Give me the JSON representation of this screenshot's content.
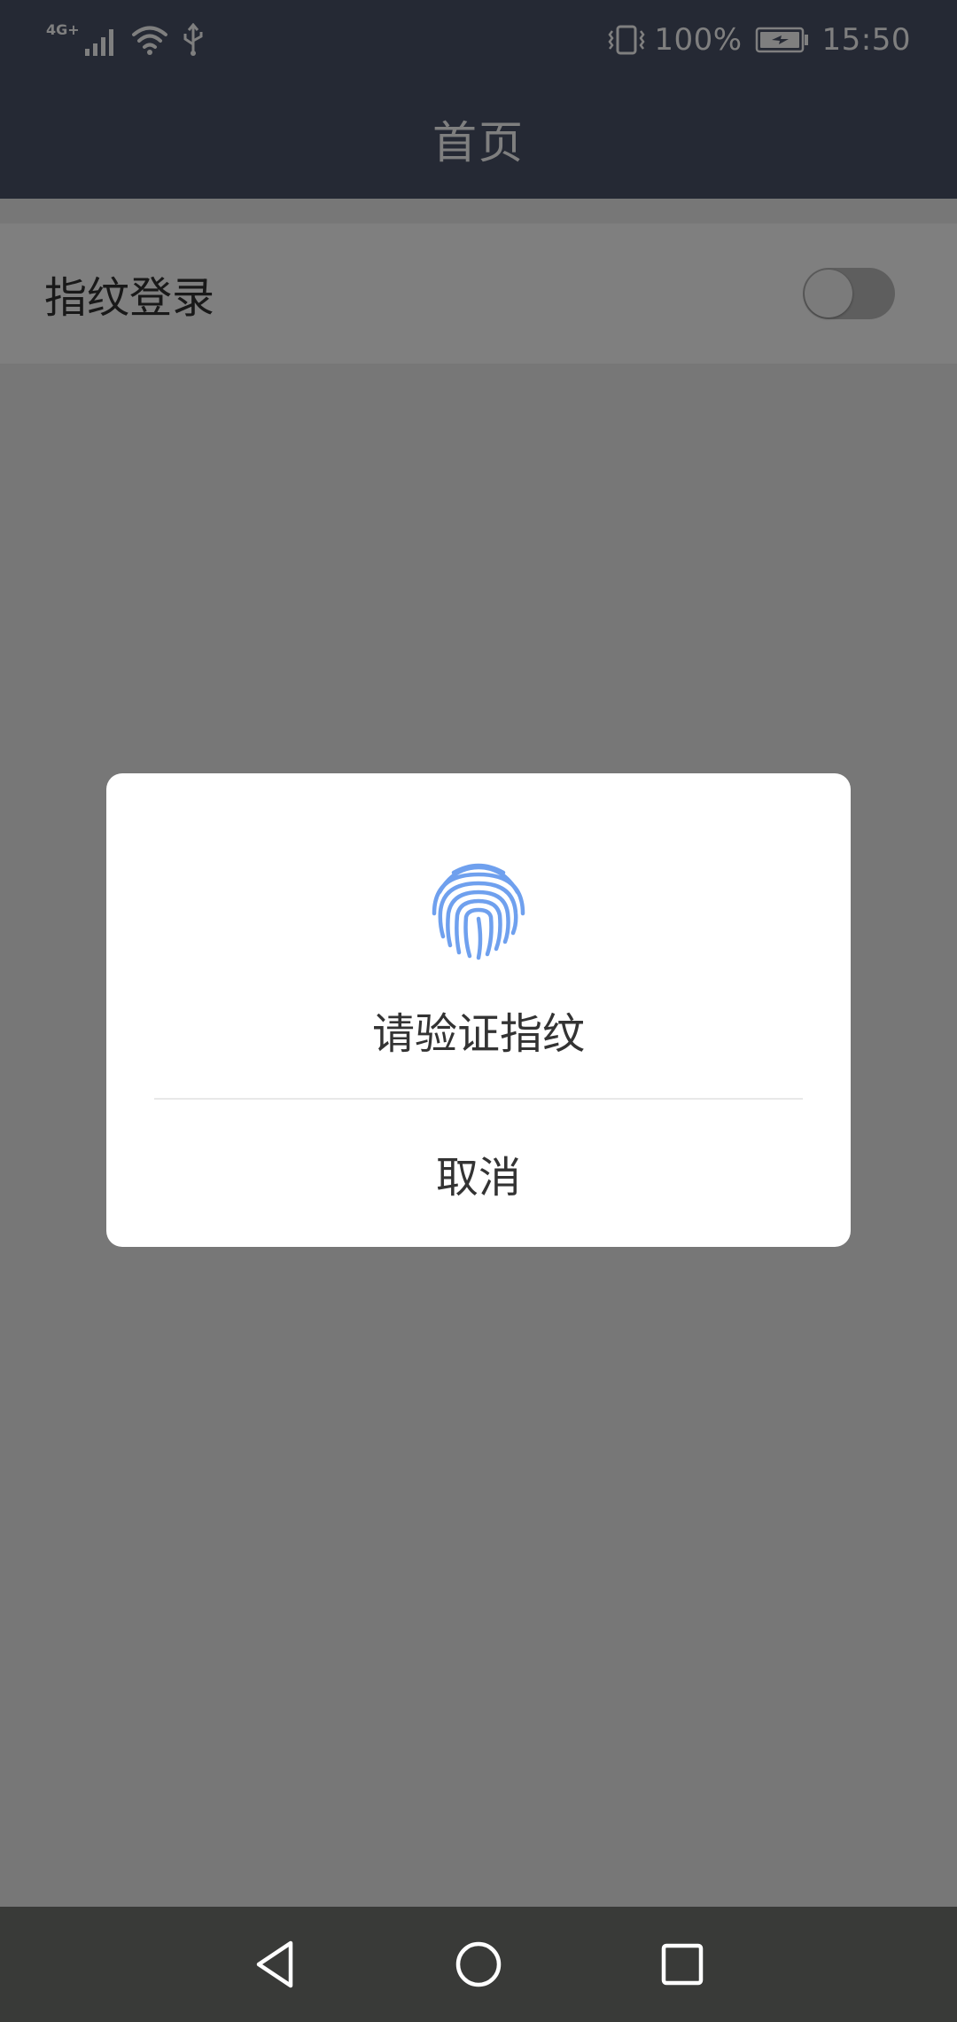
{
  "status_bar": {
    "network": "4G+",
    "battery": "100%",
    "time": "15:50",
    "icons": [
      "signal-icon",
      "wifi-icon",
      "usb-icon",
      "vibrate-icon",
      "battery-charging-icon"
    ]
  },
  "app_bar": {
    "title": "首页"
  },
  "setting": {
    "label": "指纹登录",
    "toggle_on": false
  },
  "dialog": {
    "icon": "fingerprint-icon",
    "title": "请验证指纹",
    "cancel_label": "取消",
    "icon_color": "#6fa0ee"
  },
  "nav_bar": {
    "icons": [
      "back-icon",
      "home-icon",
      "recents-icon"
    ]
  },
  "colors": {
    "app_bar": "#4a5269",
    "nav_bar": "#393a38",
    "accent": "#6fa0ee"
  }
}
